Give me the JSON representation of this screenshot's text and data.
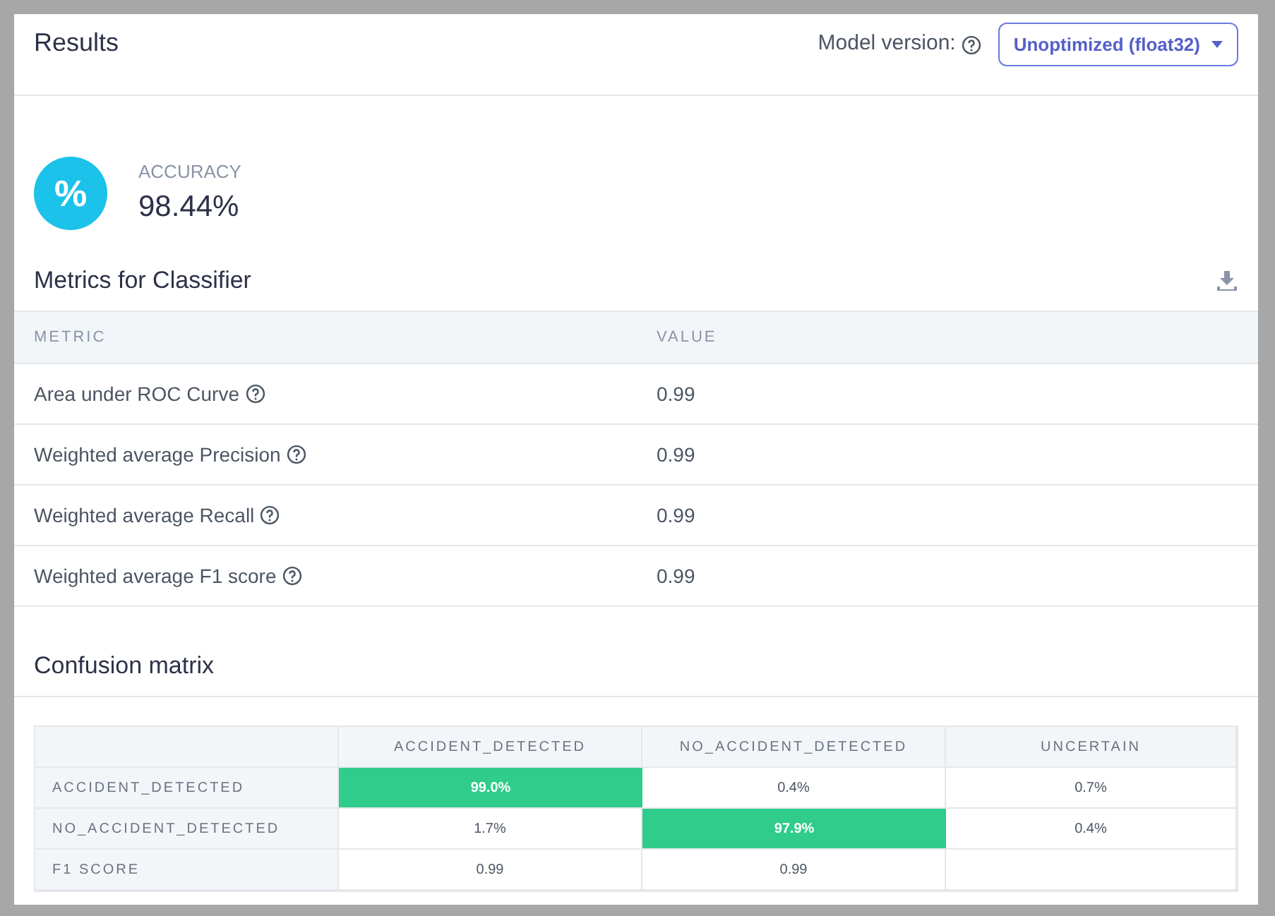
{
  "header": {
    "title": "Results",
    "model_version_label": "Model version:",
    "model_version_value": "Unoptimized (float32)"
  },
  "accuracy": {
    "label": "ACCURACY",
    "value": "98.44%",
    "icon_text": "%"
  },
  "metrics": {
    "title": "Metrics for Classifier",
    "columns": [
      "METRIC",
      "VALUE"
    ],
    "rows": [
      {
        "metric": "Area under ROC Curve",
        "value": "0.99"
      },
      {
        "metric": "Weighted average Precision",
        "value": "0.99"
      },
      {
        "metric": "Weighted average Recall",
        "value": "0.99"
      },
      {
        "metric": "Weighted average F1 score",
        "value": "0.99"
      }
    ]
  },
  "confusion_matrix": {
    "title": "Confusion matrix",
    "columns": [
      "ACCIDENT_DETECTED",
      "NO_ACCIDENT_DETECTED",
      "UNCERTAIN"
    ],
    "rows": [
      {
        "label": "ACCIDENT_DETECTED",
        "cells": [
          {
            "text": "99.0%",
            "highlight": true
          },
          {
            "text": "0.4%",
            "highlight": false
          },
          {
            "text": "0.7%",
            "highlight": false
          }
        ]
      },
      {
        "label": "NO_ACCIDENT_DETECTED",
        "cells": [
          {
            "text": "1.7%",
            "highlight": false
          },
          {
            "text": "97.9%",
            "highlight": true
          },
          {
            "text": "0.4%",
            "highlight": false
          }
        ]
      },
      {
        "label": "F1 SCORE",
        "cells": [
          {
            "text": "0.99",
            "highlight": false
          },
          {
            "text": "0.99",
            "highlight": false
          }
        ]
      }
    ]
  }
}
